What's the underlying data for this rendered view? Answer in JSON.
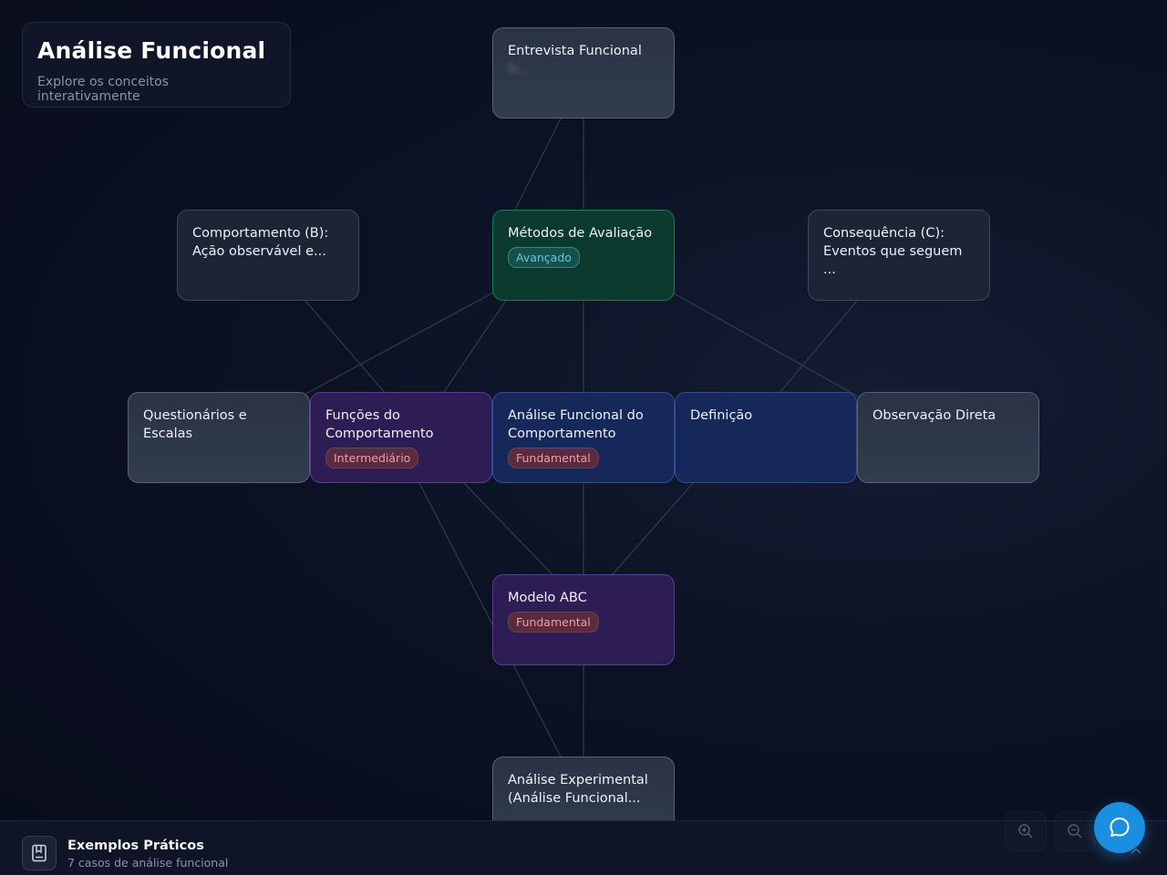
{
  "header": {
    "title": "Análise Funcional",
    "subtitle": "Explore os conceitos interativamente"
  },
  "nodes": {
    "entrevista": {
      "label": "Entrevista Funcional",
      "sub": "N..."
    },
    "metodos": {
      "label": "Métodos de Avaliação",
      "badge": "Avançado"
    },
    "comportamento_b": {
      "label": "Comportamento (B): Ação observável e..."
    },
    "consequencia_c": {
      "label": "Consequência (C): Eventos que seguem ..."
    },
    "questionarios": {
      "label": "Questionários e Escalas"
    },
    "funcoes": {
      "label": "Funções do Comportamento",
      "badge": "Intermediário"
    },
    "analise_funcional": {
      "label": "Análise Funcional do Comportamento",
      "badge": "Fundamental"
    },
    "definicao": {
      "label": "Definição"
    },
    "observacao": {
      "label": "Observação Direta"
    },
    "modelo_abc": {
      "label": "Modelo ABC",
      "badge": "Fundamental"
    },
    "analise_experimental": {
      "label": "Análise Experimental (Análise Funcional..."
    }
  },
  "bottom_bar": {
    "title": "Exemplos Práticos",
    "subtitle": "7 casos de análise funcional"
  },
  "icons": {
    "book": "book-icon",
    "zoom_in": "zoom-in-icon",
    "zoom_out": "zoom-out-icon",
    "chat": "chat-bubble-icon",
    "chevron": "chevron-up-icon"
  },
  "colors": {
    "accent": "#1a8ee0",
    "node_green": "#0d3a2e",
    "node_purple": "#2e1d54",
    "node_blue": "#16285a",
    "badge_red": "#5a2a3e",
    "badge_teal": "#16504a"
  }
}
